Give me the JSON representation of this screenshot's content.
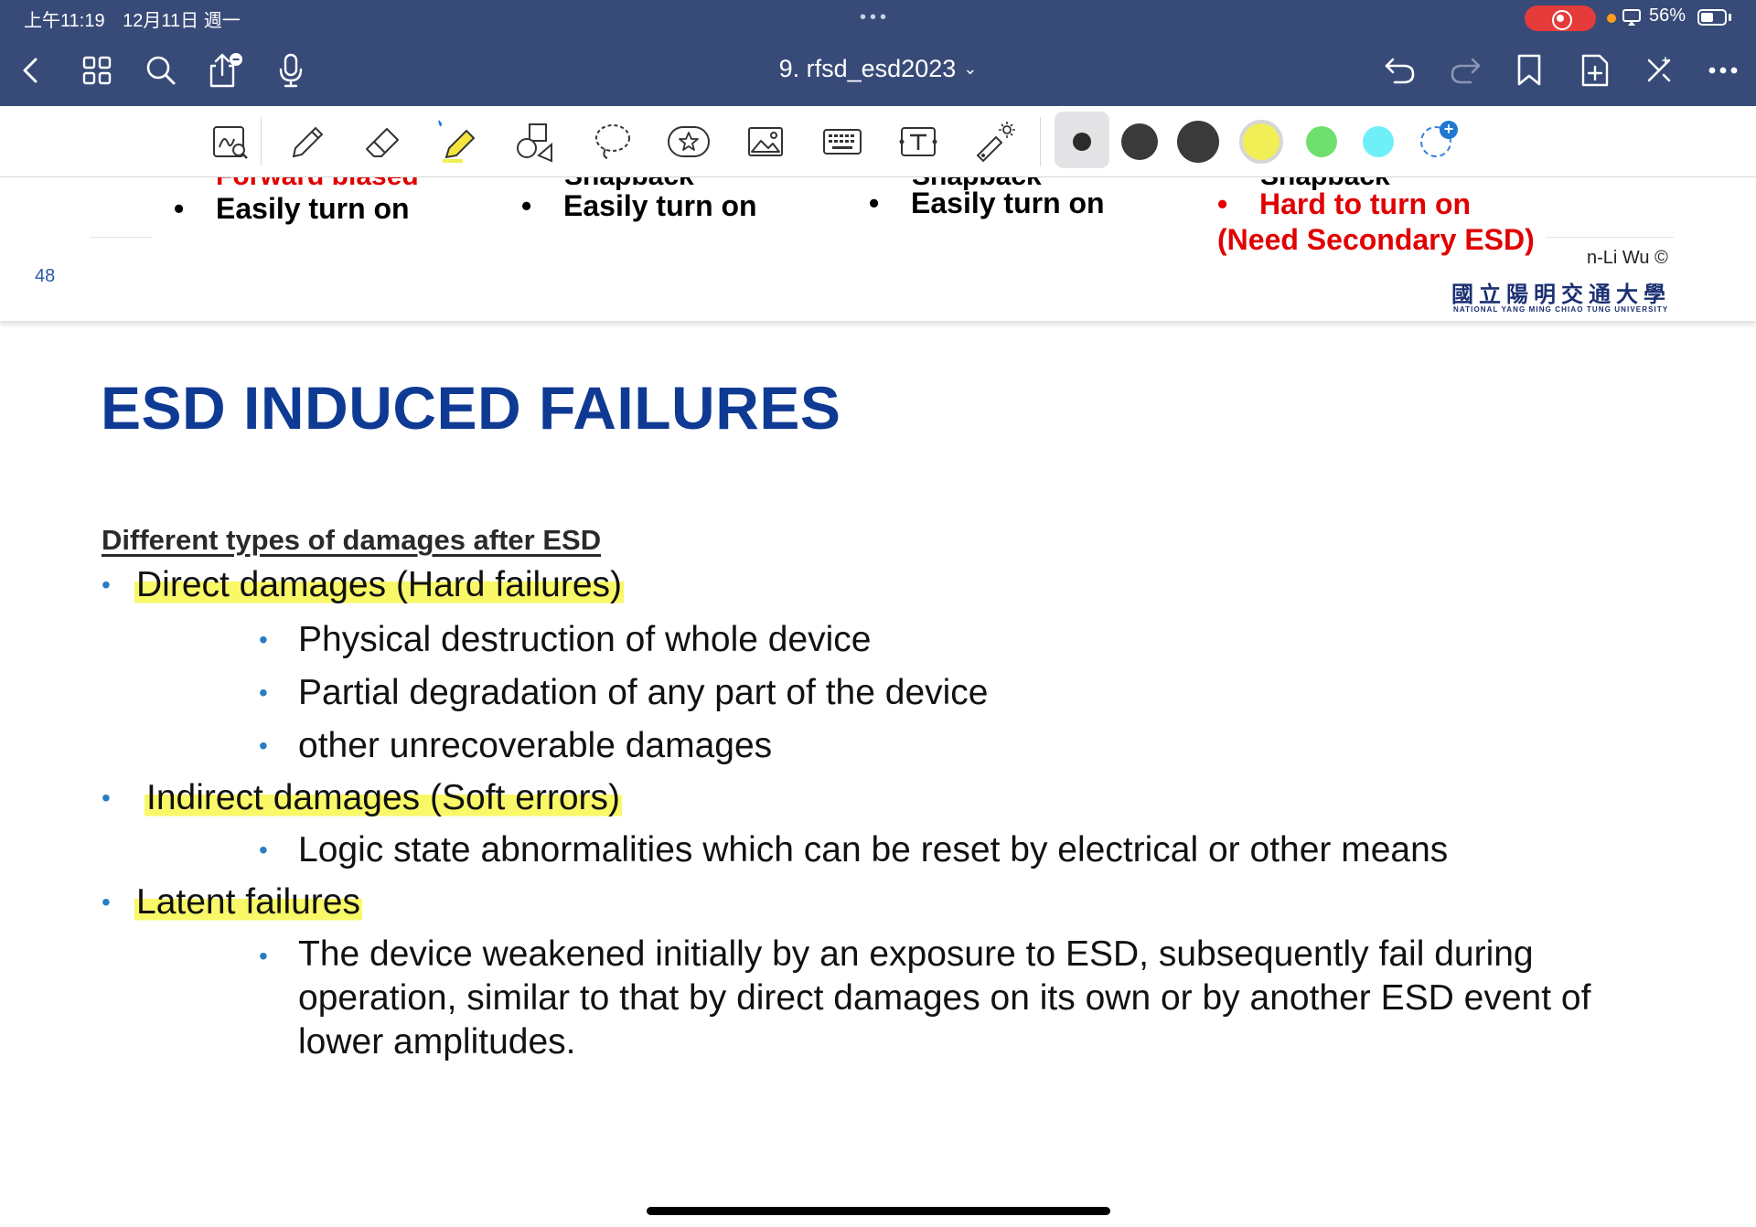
{
  "status_bar": {
    "time": "上午11:19",
    "date": "12月11日 週一",
    "dots": "•••",
    "battery_pct": "56%",
    "battery_level": 0.56,
    "rec_color": "#e53b3b"
  },
  "nav": {
    "title": "9. rfsd_esd2023",
    "chevron": "⌄",
    "bg_color": "#384b78"
  },
  "toolbar": {
    "tools": [
      "lasso-zoom-icon",
      "pen-icon",
      "eraser-icon",
      "highlighter-icon",
      "shapes-icon",
      "lasso-icon",
      "sticker-icon",
      "image-icon",
      "keyboard-icon",
      "text-box-icon",
      "laser-pointer-icon"
    ],
    "colors": [
      "#2b2b2b",
      "#3a3a3a",
      "#3a3a3a",
      "#f2ef56",
      "#6ee06e",
      "#6ff0f8"
    ],
    "add_color": "+"
  },
  "prev_page": {
    "cut_labels": [
      "Forward biased",
      "Snapback",
      "Snapback",
      "Snapback"
    ],
    "bullets": [
      {
        "dot": "•",
        "text": "Easily turn on"
      },
      {
        "dot": "•",
        "text": "Easily turn on"
      },
      {
        "dot": "•",
        "text": "Easily turn on"
      }
    ],
    "red_line1": "Hard to turn on",
    "red_line2": "(Need Secondary ESD)",
    "page_number": "48",
    "author": "n-Li Wu ©",
    "university_cn": "國立陽明交通大學",
    "university_en": "NATIONAL YANG MING CHIAO TUNG UNIVERSITY"
  },
  "slide": {
    "title": "ESD INDUCED FAILURES",
    "subheading": "Different types of damages after ESD",
    "bullet_char": "•",
    "items": [
      {
        "level": 1,
        "text": "Direct damages (Hard failures)"
      },
      {
        "level": 2,
        "text": "Physical destruction of whole device"
      },
      {
        "level": 2,
        "text": "Partial degradation of any part of the device"
      },
      {
        "level": 2,
        "text": "other unrecoverable damages"
      },
      {
        "level": 1,
        "text": "Indirect damages (Soft errors)"
      },
      {
        "level": 2,
        "text": "Logic state abnormalities which can be reset by electrical or other means"
      },
      {
        "level": 1,
        "text": "Latent failures"
      },
      {
        "level": 2,
        "text": "The device weakened initially by an exposure to ESD, subsequently fail during operation, similar to that by direct damages on its own or by another ESD event of lower amplitudes."
      }
    ],
    "title_color": "#0f3a94",
    "highlight_color": "#f8f646"
  }
}
